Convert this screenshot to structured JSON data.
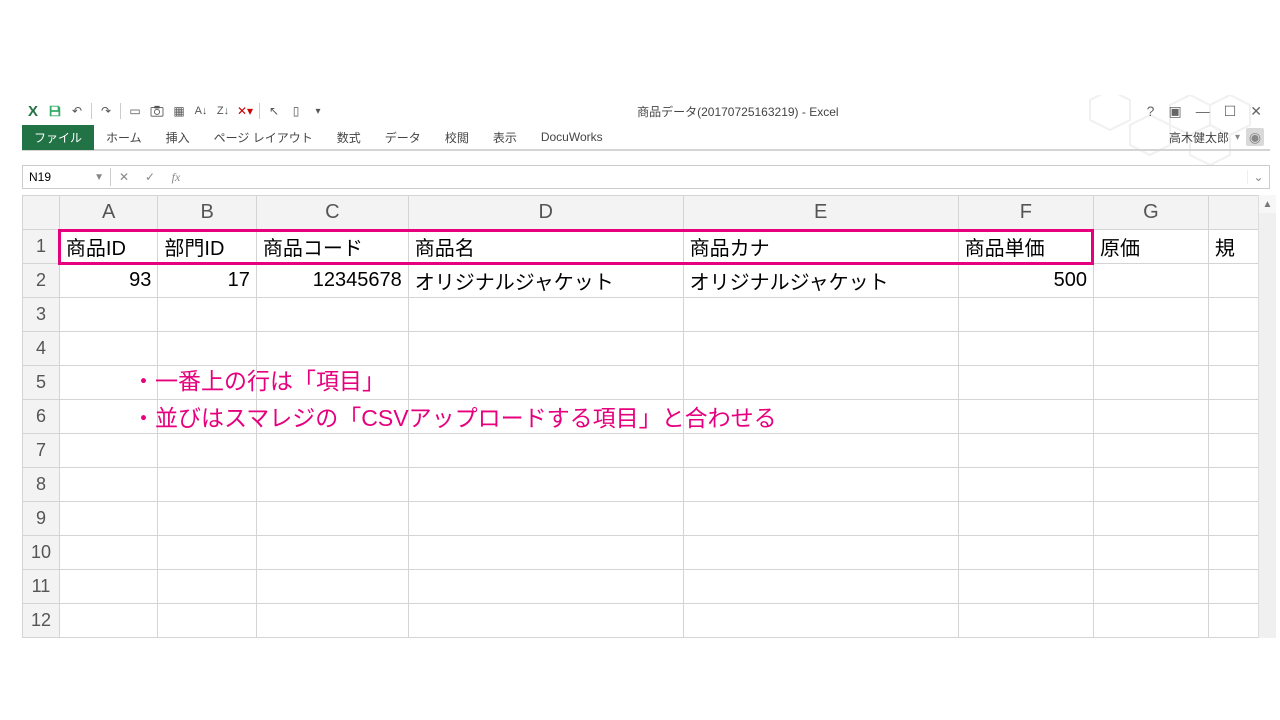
{
  "window": {
    "title": "商品データ(20170725163219) - Excel",
    "user_name": "高木健太郎"
  },
  "ribbon": {
    "tabs": [
      "ファイル",
      "ホーム",
      "挿入",
      "ページ レイアウト",
      "数式",
      "データ",
      "校閲",
      "表示",
      "DocuWorks"
    ],
    "active_index": 0
  },
  "namebox": {
    "value": "N19"
  },
  "formula": {
    "value": ""
  },
  "columns": [
    "A",
    "B",
    "C",
    "D",
    "E",
    "F",
    "G"
  ],
  "partial_col": "規",
  "row_count": 12,
  "headers_row": {
    "A": "商品ID",
    "B": "部門ID",
    "C": "商品コード",
    "D": "商品名",
    "E": "商品カナ",
    "F": "商品単価",
    "G": "原価"
  },
  "data_row": {
    "A": "93",
    "B": "17",
    "C": "12345678",
    "D": "オリジナルジャケット",
    "E": "オリジナルジャケット",
    "F": "500",
    "G": ""
  },
  "annotation": {
    "line1": "・一番上の行は「項目」",
    "line2": "・並びはスマレジの「CSVアップロードする項目」と合わせる"
  }
}
